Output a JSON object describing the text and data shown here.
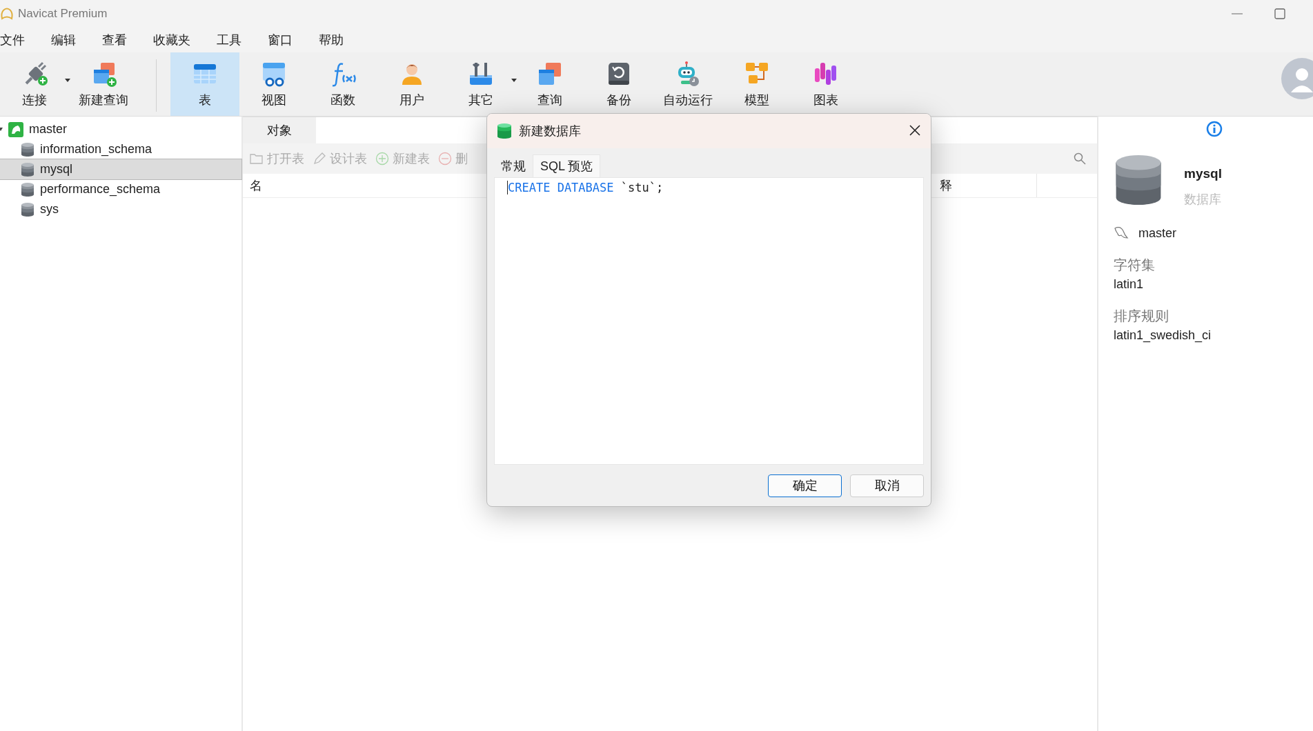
{
  "window": {
    "title": "Navicat Premium"
  },
  "menu": [
    "文件",
    "编辑",
    "查看",
    "收藏夹",
    "工具",
    "窗口",
    "帮助"
  ],
  "toolbar": [
    {
      "label": "连接",
      "kind": "connect",
      "selected": false,
      "dropdown": true
    },
    {
      "label": "新建查询",
      "kind": "new-query",
      "selected": false,
      "dropdown": false
    },
    {
      "label": "表",
      "kind": "table",
      "selected": true,
      "dropdown": false
    },
    {
      "label": "视图",
      "kind": "view",
      "selected": false,
      "dropdown": false
    },
    {
      "label": "函数",
      "kind": "function",
      "selected": false,
      "dropdown": false
    },
    {
      "label": "用户",
      "kind": "user",
      "selected": false,
      "dropdown": false
    },
    {
      "label": "其它",
      "kind": "tools",
      "selected": false,
      "dropdown": true
    },
    {
      "label": "查询",
      "kind": "query",
      "selected": false,
      "dropdown": false
    },
    {
      "label": "备份",
      "kind": "backup",
      "selected": false,
      "dropdown": false
    },
    {
      "label": "自动运行",
      "kind": "robot",
      "selected": false,
      "dropdown": false
    },
    {
      "label": "模型",
      "kind": "model",
      "selected": false,
      "dropdown": false
    },
    {
      "label": "图表",
      "kind": "chart",
      "selected": false,
      "dropdown": false
    }
  ],
  "tree": {
    "label": "master",
    "expanded": true,
    "children": [
      {
        "label": "information_schema",
        "selected": false
      },
      {
        "label": "mysql",
        "selected": true
      },
      {
        "label": "performance_schema",
        "selected": false
      },
      {
        "label": "sys",
        "selected": false
      }
    ]
  },
  "objects": {
    "tabs": [
      {
        "label": "对象",
        "selected": true
      }
    ],
    "actions": [
      {
        "label": "打开表",
        "kind": "open",
        "disabled": true
      },
      {
        "label": "设计表",
        "kind": "design",
        "disabled": true
      },
      {
        "label": "新建表",
        "kind": "add",
        "disabled": true
      },
      {
        "label": "删",
        "kind": "remove",
        "disabled": true
      }
    ],
    "columns": [
      "名",
      "释"
    ]
  },
  "dialog": {
    "title": "新建数据库",
    "tabs": [
      {
        "label": "常规",
        "selected": false
      },
      {
        "label": "SQL 预览",
        "selected": true
      }
    ],
    "sql": [
      {
        "text": "CREATE DATABASE",
        "kind": "keyword"
      },
      {
        "text": " `stu`;",
        "kind": "plain"
      }
    ],
    "buttons": [
      {
        "label": "确定",
        "default": true
      },
      {
        "label": "取消",
        "default": false
      }
    ]
  },
  "info": {
    "name": "mysql",
    "type": "数据库",
    "connection": "master",
    "fields": [
      {
        "label": "字符集",
        "value": "latin1"
      },
      {
        "label": "排序规则",
        "value": "latin1_swedish_ci"
      }
    ]
  }
}
